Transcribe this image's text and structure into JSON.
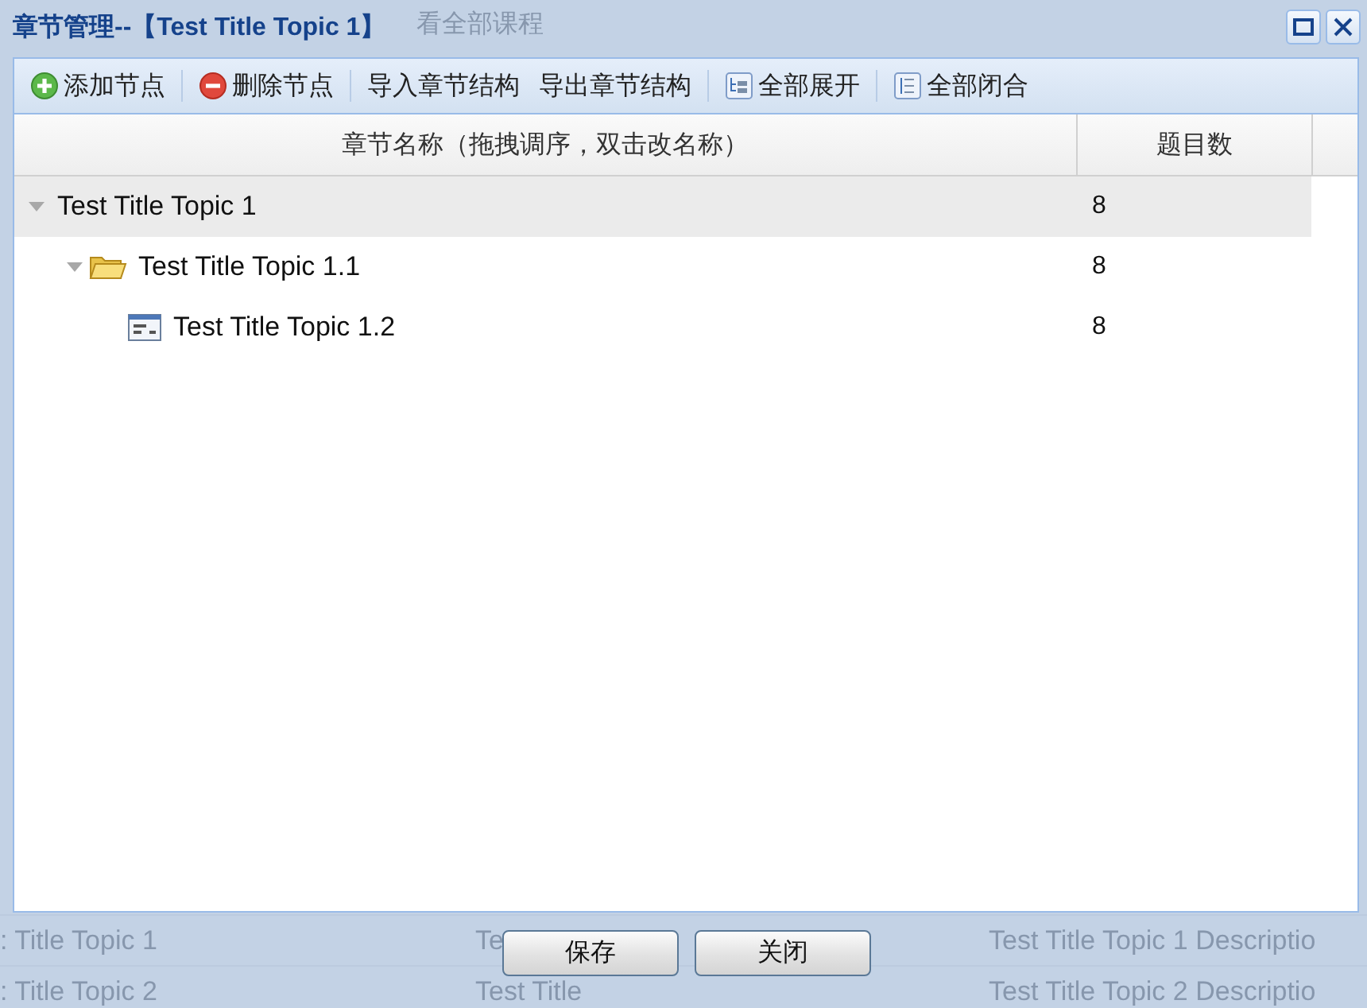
{
  "background": {
    "top_text": "看全部课程",
    "rows": [
      {
        "cells": [
          ": Title Topic 1",
          "Te",
          "Test Title Topic 1 Descriptio"
        ]
      },
      {
        "cells": [
          ": Title Topic 2",
          "Test Title",
          "Test Title Topic 2 Descriptio"
        ]
      }
    ]
  },
  "window": {
    "title": "章节管理--【Test Title Topic 1】"
  },
  "toolbar": [
    {
      "label": "添加节点",
      "kind": "add",
      "separator_before": false
    },
    {
      "label": "删除节点",
      "kind": "remove",
      "separator_before": true
    },
    {
      "label": "导入章节结构",
      "kind": "plain",
      "separator_before": true
    },
    {
      "label": "导出章节结构",
      "kind": "plain",
      "separator_before": false
    },
    {
      "label": "全部展开",
      "kind": "expand",
      "separator_before": true
    },
    {
      "label": "全部闭合",
      "kind": "collapse",
      "separator_before": true
    }
  ],
  "tree": {
    "columns": [
      "章节名称（拖拽调序，双击改名称）",
      "题目数"
    ],
    "nodes": [
      {
        "name": "Test Title Topic 1",
        "count": "8",
        "expanded": true,
        "selected": true,
        "children": [
          {
            "name": "Test Title Topic 1.1",
            "count": "8",
            "kind": "folder",
            "expanded": true,
            "selected": false,
            "children": [
              {
                "name": "Test Title Topic 1.2",
                "count": "8",
                "kind": "page",
                "selected": false
              }
            ]
          }
        ]
      }
    ]
  },
  "buttons": [
    "保存",
    "关闭"
  ]
}
